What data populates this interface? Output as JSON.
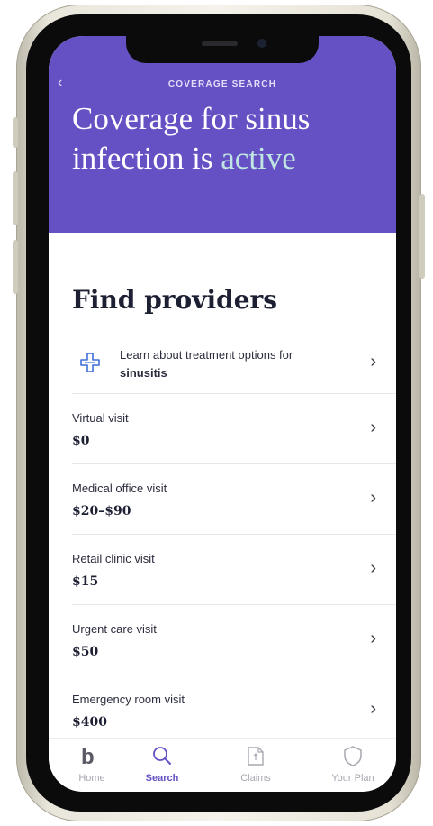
{
  "header": {
    "back_glyph": "‹",
    "eyebrow": "COVERAGE SEARCH",
    "title_main": "Coverage for sinus infection is ",
    "title_accent": "active"
  },
  "providers": {
    "title": "Find providers",
    "info": {
      "icon": "medical-cross-icon",
      "text": "Learn about treatment options for",
      "bold_text": "sinusitis"
    },
    "rows": [
      {
        "label": "Virtual visit",
        "price": "$0"
      },
      {
        "label": "Medical office visit",
        "price": "$20–$90"
      },
      {
        "label": "Retail clinic visit",
        "price": "$15"
      },
      {
        "label": "Urgent care visit",
        "price": "$50"
      },
      {
        "label": "Emergency room visit",
        "price": "$400"
      }
    ],
    "chevron": "›"
  },
  "tabbar": {
    "tabs": [
      {
        "label": "Home",
        "icon": "brand-b-icon"
      },
      {
        "label": "Search",
        "icon": "search-icon",
        "active": true
      },
      {
        "label": "Claims",
        "icon": "claims-document-icon"
      },
      {
        "label": "Your Plan",
        "icon": "shield-icon"
      }
    ]
  },
  "colors": {
    "accent": "#6651c4",
    "header_bg": "#6651c4",
    "accent_text": "#bfe6e2"
  }
}
